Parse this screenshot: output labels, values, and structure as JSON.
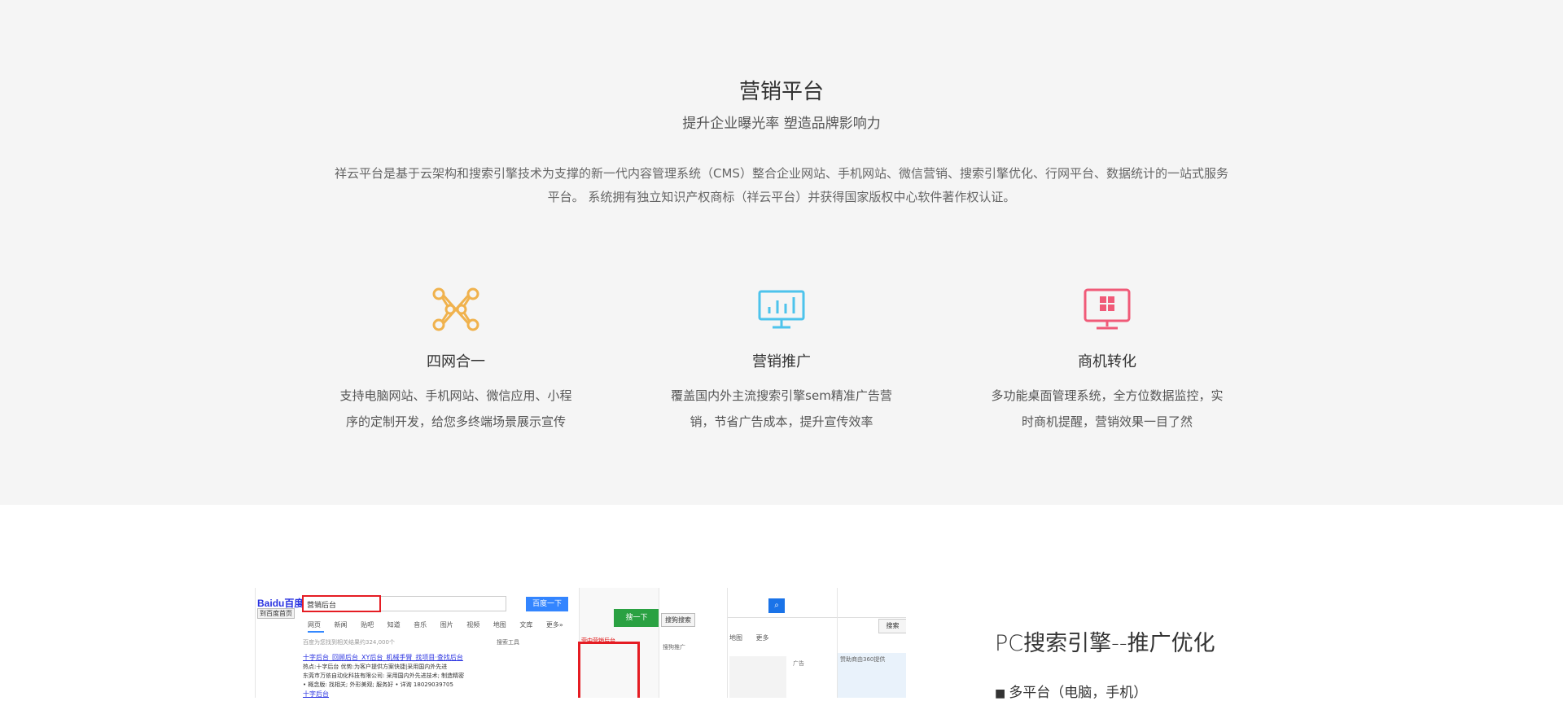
{
  "section": {
    "title": "营销平台",
    "subtitle": "提升企业曝光率 塑造品牌影响力",
    "description_line1": "祥云平台是基于云架构和搜索引擎技术为支撑的新一代内容管理系统（CMS）整合企业网站、手机网站、微信营销、搜索引擎优化、行网平台、数据统计的一站式服务",
    "description_line2": "平台。 系统拥有独立知识产权商标（祥云平台）并获得国家版权中心软件著作权认证。"
  },
  "features": [
    {
      "title": "四网合一",
      "text_line1": "支持电脑网站、手机网站、微信应用、小程",
      "text_line2": "序的定制开发，给您多终端场景展示宣传",
      "icon": "network-nodes-icon",
      "color": "#f0b24d"
    },
    {
      "title": "营销推广",
      "text_line1": "覆盖国内外主流搜索引擎sem精准广告营",
      "text_line2": "销，节省广告成本，提升宣传效率",
      "icon": "presentation-chart-icon",
      "color": "#4dc3ec"
    },
    {
      "title": "商机转化",
      "text_line1": "多功能桌面管理系统，全方位数据监控，实",
      "text_line2": "时商机提醒，营销效果一目了然",
      "icon": "monitor-windows-icon",
      "color": "#f05a78"
    }
  ],
  "collage": {
    "logo_a": "Bai",
    "logo_b": "du",
    "logo_c": "百度",
    "home_btn": "到百度首页",
    "query": "营销后台",
    "search_btn": "百度一下",
    "tabs": "网页 新闻 贴吧 知道 音乐 图片 视频 地图 文库 更多»",
    "result_meta": "百度为您找到相关结果约324,000个",
    "tools": "搜索工具",
    "r1": "十字后台_回顾后台_XY后台_机械手臂_找项目·查找后台",
    "r1_text": "热点:十字后台 优势:为客户提供方案快捷|采用国内外先进",
    "r2_text": "东莞市万依自动化科技有限公司: 采用国内外先进技术; 制造精密",
    "r3_text": "• 概念版: 找相关; 外形美观; 服务好 • 详询 18029039705",
    "r4": "十字后台",
    "green_btn": "搜一下",
    "hint": "营中营销后台",
    "srch_btn": "搜狗搜索",
    "promo": "搜狗推广",
    "nav": "地图 更多",
    "ad": "广告",
    "btn2": "搜索",
    "ad2": "赞助商由360提供"
  },
  "right": {
    "title": "PC搜索引擎--推广优化",
    "item1": "多平台（电脑，手机）",
    "bullet": "■"
  }
}
